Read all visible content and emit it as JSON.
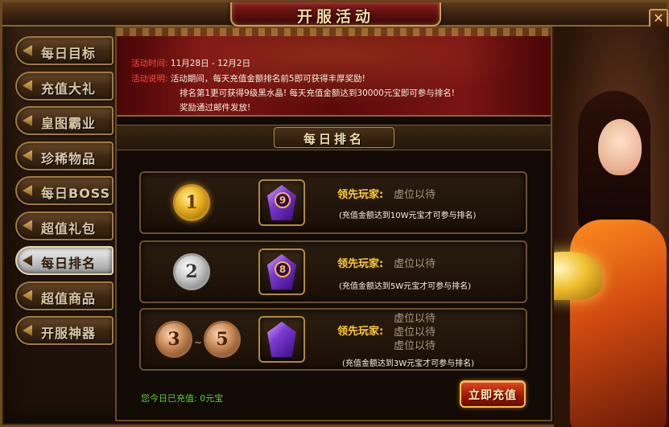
{
  "window": {
    "title": "开服活动",
    "close_label": "✕"
  },
  "sidebar": {
    "items": [
      {
        "label": "每日目标",
        "active": false
      },
      {
        "label": "充值大礼",
        "active": false
      },
      {
        "label": "皇图霸业",
        "active": false
      },
      {
        "label": "珍稀物品",
        "active": false
      },
      {
        "label": "每日BOSS",
        "active": false
      },
      {
        "label": "超值礼包",
        "active": false
      },
      {
        "label": "每日排名",
        "active": true
      },
      {
        "label": "超值商品",
        "active": false
      },
      {
        "label": "开服神器",
        "active": false
      }
    ]
  },
  "banner": {
    "time_label": "活动时间:",
    "time_value": "11月28日 - 12月2日",
    "desc_label": "活动说明:",
    "desc_line1": "活动期间，每天充值金额排名前5即可获得丰厚奖励!",
    "desc_line2": "排名第1更可获得9级黑水晶! 每天充值金额达到30000元宝即可参与排名!",
    "desc_line3": "奖励通过邮件发放!"
  },
  "section": {
    "title": "每日排名"
  },
  "ranks": [
    {
      "medal": "1",
      "medal_style": "gold",
      "gem_level": "9",
      "leader_label": "领先玩家:",
      "leaders": [
        "虚位以待"
      ],
      "requirement": "(充值金额达到10W元宝才可参与排名)"
    },
    {
      "medal": "2",
      "medal_style": "silver",
      "gem_level": "8",
      "leader_label": "领先玩家:",
      "leaders": [
        "虚位以待"
      ],
      "requirement": "(充值金额达到5W元宝才可参与排名)"
    },
    {
      "medal": "3",
      "medal_end": "5",
      "tilde": "~",
      "medal_style": "bronze",
      "gem_level": "",
      "leader_label": "领先玩家:",
      "leaders": [
        "虚位以待",
        "虚位以待",
        "虚位以待"
      ],
      "requirement": "(充值金额达到3W元宝才可参与排名)"
    }
  ],
  "footer": {
    "today_label": "您今日已充值: 0元宝",
    "recharge_button": "立即充值"
  },
  "colors": {
    "accent_gold": "#f0c050",
    "leader_label": "#ffcc30",
    "banner_label": "#ff4a3a",
    "today_green": "#5ad03a"
  }
}
